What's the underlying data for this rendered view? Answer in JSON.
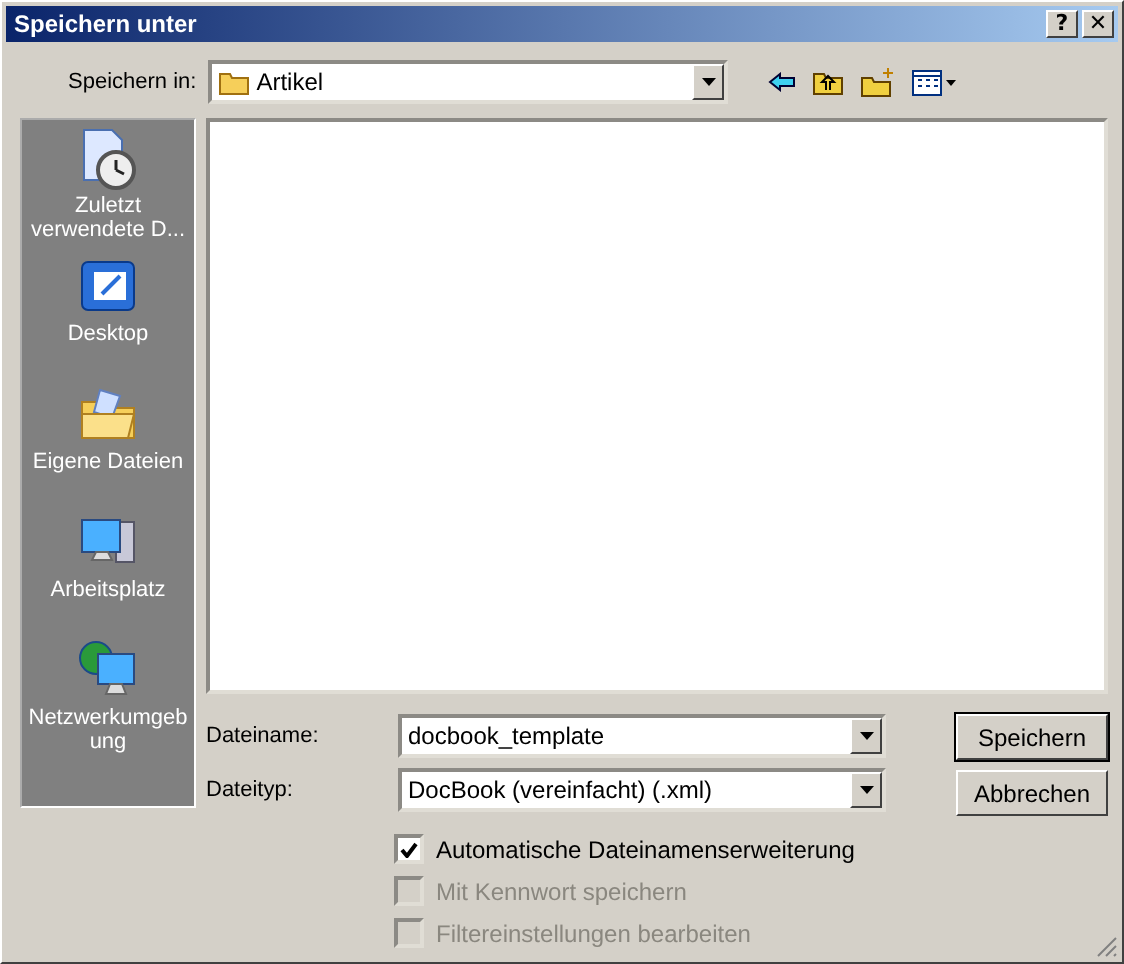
{
  "window": {
    "title": "Speichern unter"
  },
  "title_buttons": [
    {
      "label": "?"
    },
    {
      "label": "✕"
    }
  ],
  "save_in": {
    "label": "Speichern in:",
    "value": "Artikel"
  },
  "toolbar": [
    {
      "kind": "back"
    },
    {
      "kind": "up"
    },
    {
      "kind": "new-folder"
    },
    {
      "kind": "view"
    }
  ],
  "places": [
    {
      "kind": "recent",
      "label": "Zuletzt verwendete D..."
    },
    {
      "kind": "desktop",
      "label": "Desktop"
    },
    {
      "kind": "documents",
      "label": "Eigene Dateien"
    },
    {
      "kind": "computer",
      "label": "Arbeitsplatz"
    },
    {
      "kind": "network",
      "label": "Netzwerkumgebung"
    }
  ],
  "fields": [
    {
      "label": "Dateiname:",
      "value": "docbook_template"
    },
    {
      "label": "Dateityp:",
      "value": "DocBook (vereinfacht) (.xml)"
    }
  ],
  "buttons": [
    {
      "label": "Speichern",
      "default": true
    },
    {
      "label": "Abbrechen",
      "default": false
    }
  ],
  "options": [
    {
      "label": "Automatische Dateinamenserweiterung",
      "checked": true,
      "disabled": false
    },
    {
      "label": "Mit Kennwort speichern",
      "checked": false,
      "disabled": true
    },
    {
      "label": "Filtereinstellungen bearbeiten",
      "checked": false,
      "disabled": true
    }
  ]
}
